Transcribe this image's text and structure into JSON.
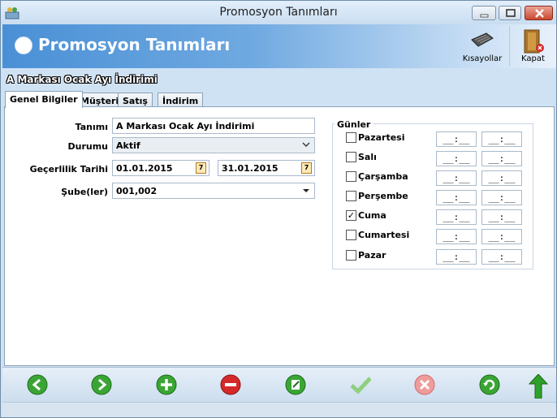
{
  "window": {
    "title": "Promosyon Tanımları"
  },
  "header": {
    "title": "Promosyon Tanımları",
    "tools": {
      "shortcuts": "Kısayollar",
      "close": "Kapat"
    }
  },
  "record_caption": "A Markası Ocak Ayı İndirimi",
  "tabs": [
    "Genel Bilgiler",
    "Müşteri",
    "Satış",
    "İndirim"
  ],
  "form": {
    "tanimi_label": "Tanımı",
    "tanimi_value": "A Markası Ocak Ayı İndirimi",
    "durumu_label": "Durumu",
    "durumu_value": "Aktif",
    "gecerlilik_label": "Geçerlilik Tarihi",
    "date_start": "01.01.2015",
    "date_end": "31.01.2015",
    "sube_label": "Şube(ler)",
    "sube_value": "001,002",
    "calendar_digit": "7"
  },
  "days": {
    "title": "Günler",
    "time_placeholder": "__:__",
    "items": [
      {
        "label": "Pazartesi",
        "checked": false
      },
      {
        "label": "Salı",
        "checked": false
      },
      {
        "label": "Çarşamba",
        "checked": false
      },
      {
        "label": "Perşembe",
        "checked": false
      },
      {
        "label": "Cuma",
        "checked": true
      },
      {
        "label": "Cumartesi",
        "checked": false
      },
      {
        "label": "Pazar",
        "checked": false
      }
    ]
  },
  "toolbar_icons": [
    "back-arrow-icon",
    "forward-arrow-icon",
    "add-icon",
    "delete-icon",
    "edit-icon",
    "confirm-check-icon",
    "cancel-x-icon",
    "refresh-icon",
    "up-arrow-icon"
  ],
  "colors": {
    "header_start": "#4a90d6",
    "window_bg": "#cfe2f4",
    "green": "#3aa534",
    "red": "#d52a2a"
  }
}
